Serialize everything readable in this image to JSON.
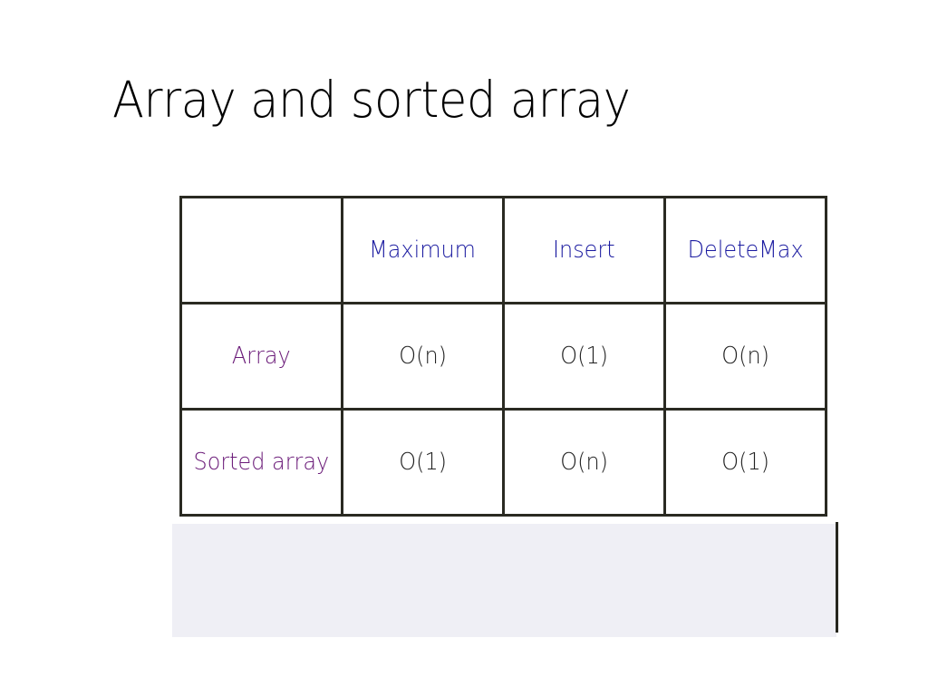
{
  "title": "Array and sorted array",
  "colors": {
    "header_text": "#1a1aa0",
    "row_label_text": "#6a1a78",
    "cell_text": "#222222",
    "grid_line": "#2a2a22",
    "panel_bg": "#efeff5"
  },
  "table": {
    "corner": "",
    "columns": [
      "Maximum",
      "Insert",
      "DeleteMax"
    ],
    "rows": [
      {
        "label": "Array",
        "values": [
          "O(n)",
          "O(1)",
          "O(n)"
        ]
      },
      {
        "label": "Sorted array",
        "values": [
          "O(1)",
          "O(n)",
          "O(1)"
        ]
      }
    ]
  }
}
